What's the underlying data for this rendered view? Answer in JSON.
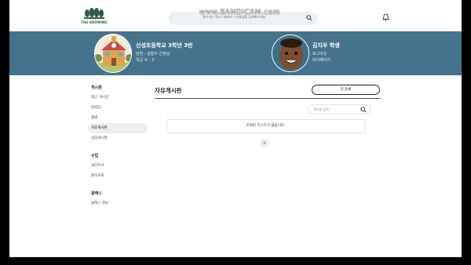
{
  "header": {
    "brand": "THE GROWING",
    "search_placeholder": "찾으시는 학교 / 클래스 / 선생님을 검색해주세요",
    "watermark": "www.BANDICAM.com"
  },
  "banner": {
    "school_name": "신성초등학교 3학년 3반",
    "teacher": "담임 : 김철수 선생님",
    "student_count": "학급 수 : 3",
    "student_name": "김지우 학생",
    "logout": "로그아웃",
    "mypage": "마이페이지"
  },
  "sidebar": {
    "sections": [
      {
        "title": "게시판",
        "items": [
          "최근 게시글",
          "알림장",
          "앨범",
          "자유게시판",
          "상담게시판"
        ]
      },
      {
        "title": "수업",
        "items": [
          "설문조사",
          "출석조회"
        ]
      },
      {
        "title": "클래스",
        "items": [
          "클래스 정보"
        ]
      }
    ],
    "active": "자유게시판"
  },
  "main": {
    "title": "자유게시판",
    "write_button": "글 등록",
    "search_placeholder": "게시판 검색",
    "empty_message": "조회된 리스트가 없습니다.",
    "next_page": ">"
  },
  "colors": {
    "banner": "#45738d",
    "brand_green": "#2f5d48",
    "active_bg": "#eceeef"
  }
}
